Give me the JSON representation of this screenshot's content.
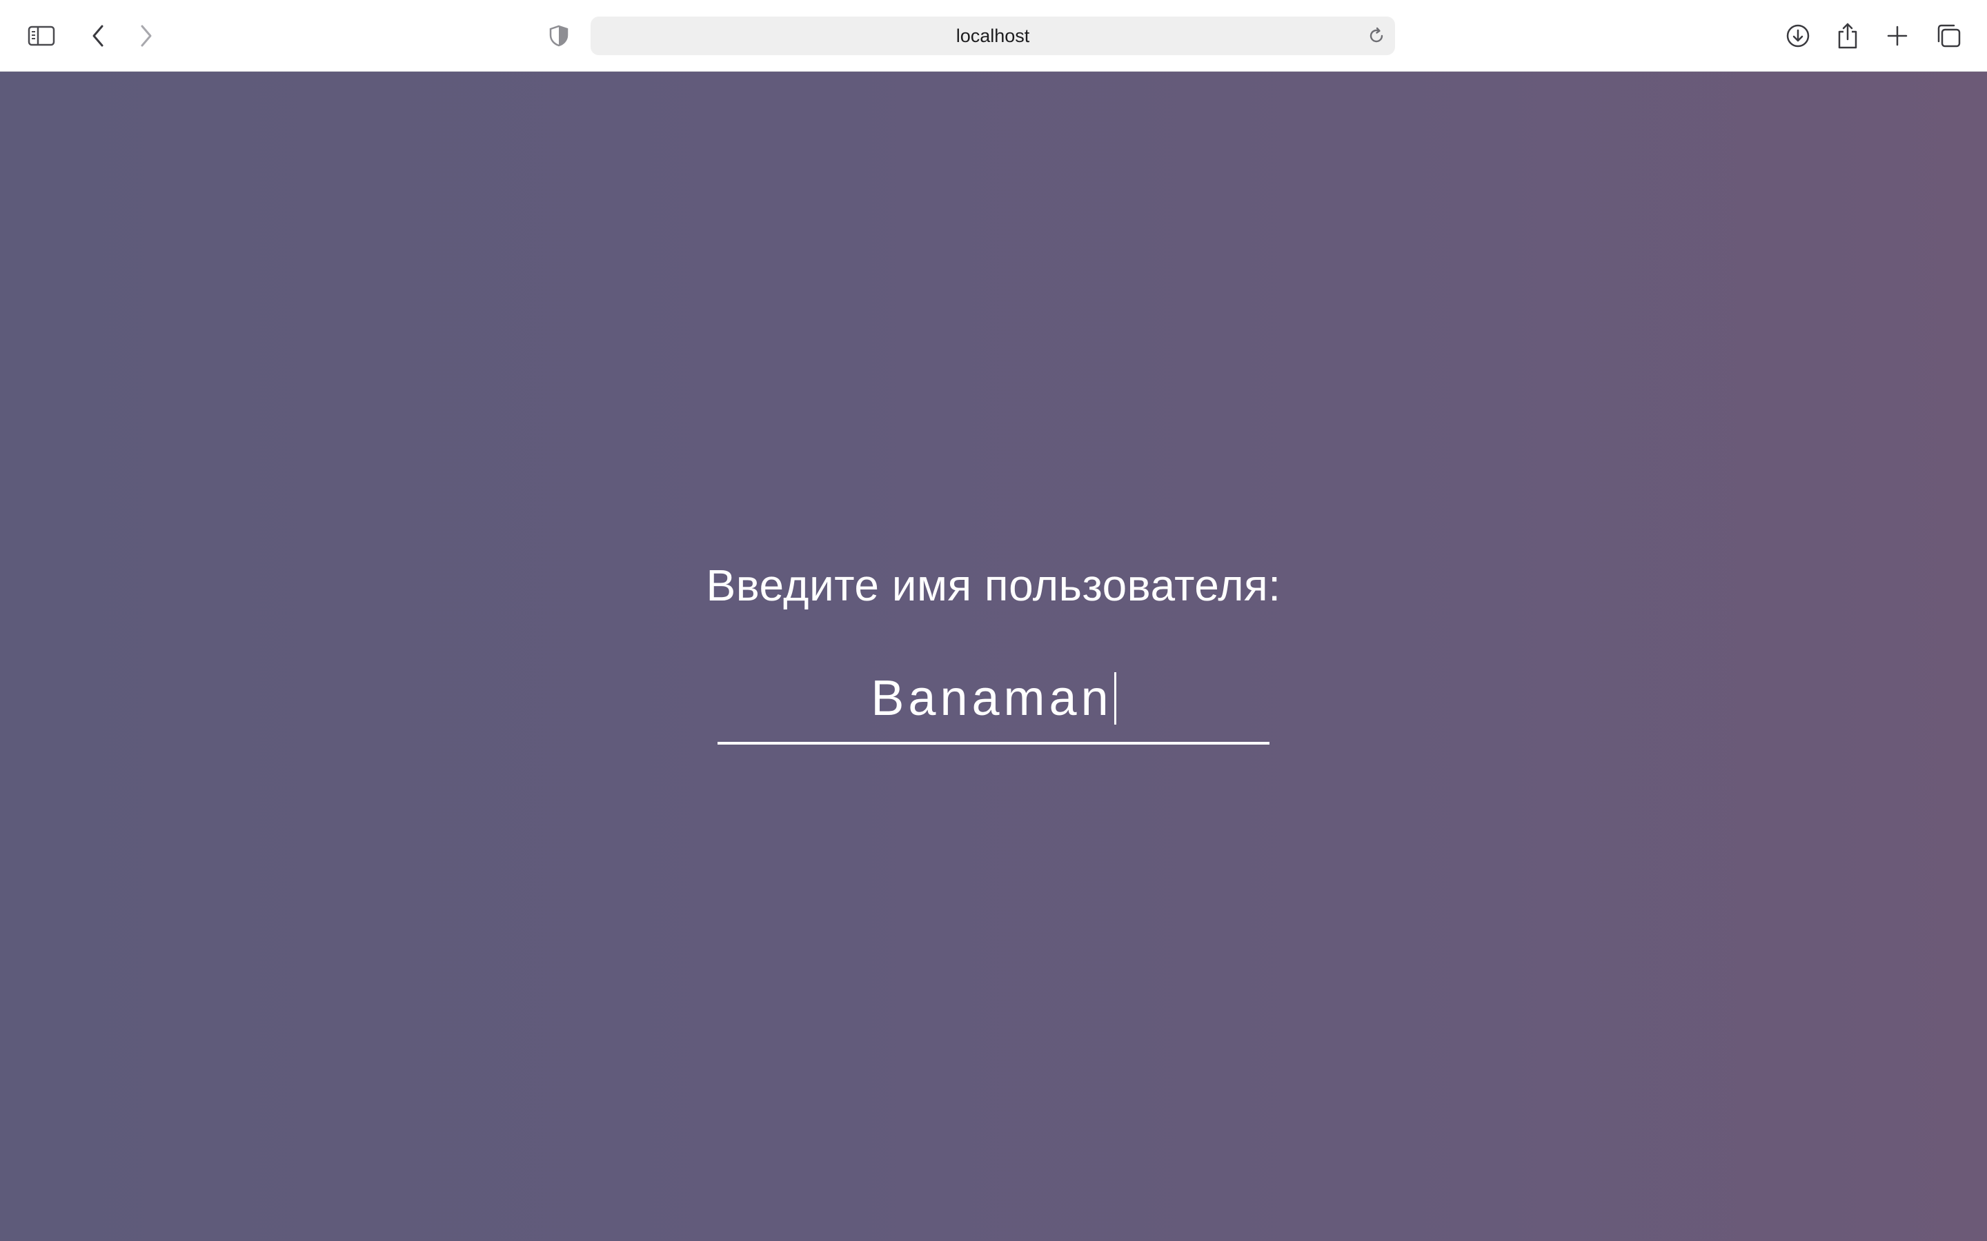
{
  "browser": {
    "address": "localhost",
    "icons": {
      "sidebar": "sidebar-icon",
      "back": "chevron-left-icon",
      "forward": "chevron-right-icon",
      "privacy": "shield-icon",
      "reload": "reload-icon",
      "downloads": "download-icon",
      "share": "share-icon",
      "new_tab": "plus-icon",
      "tabs": "tab-overview-icon"
    }
  },
  "page": {
    "prompt": "Введите имя пользователя:",
    "username_value": "Banaman"
  },
  "colors": {
    "background_left": "#5e5b7a",
    "background_right": "#6c5a77",
    "text": "#ffffff"
  }
}
